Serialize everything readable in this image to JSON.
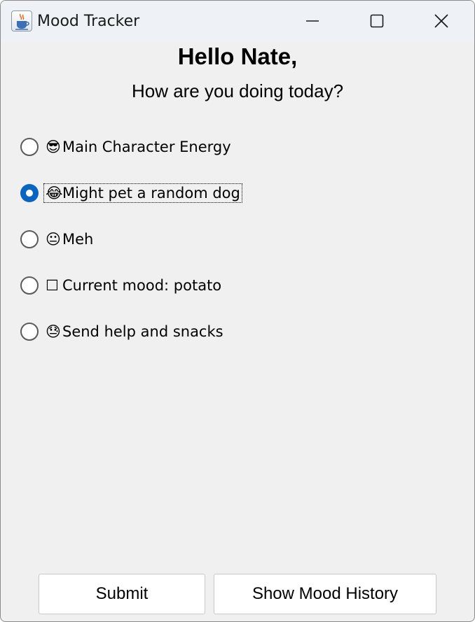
{
  "window": {
    "title": "Mood Tracker",
    "app_icon": "java-cup-icon",
    "controls": [
      "minimize-icon",
      "maximize-icon",
      "close-icon"
    ]
  },
  "main": {
    "greeting": "Hello Nate,",
    "question": "How are you doing today?"
  },
  "moods": [
    {
      "emoji": "😎",
      "label": "Main Character Energy",
      "selected": false
    },
    {
      "emoji": "😂",
      "label": "Might pet a random dog",
      "selected": true
    },
    {
      "emoji": "😐",
      "label": "Meh",
      "selected": false
    },
    {
      "emoji": "☐",
      "label": "Current mood: potato",
      "selected": false
    },
    {
      "emoji": "😓",
      "label": "Send help and snacks",
      "selected": false
    }
  ],
  "buttons": {
    "submit": "Submit",
    "history": "Show Mood History"
  },
  "colors": {
    "accent": "#0a64c2",
    "window_bg": "#f0f0f0",
    "titlebar_bg": "#eef2f7"
  }
}
